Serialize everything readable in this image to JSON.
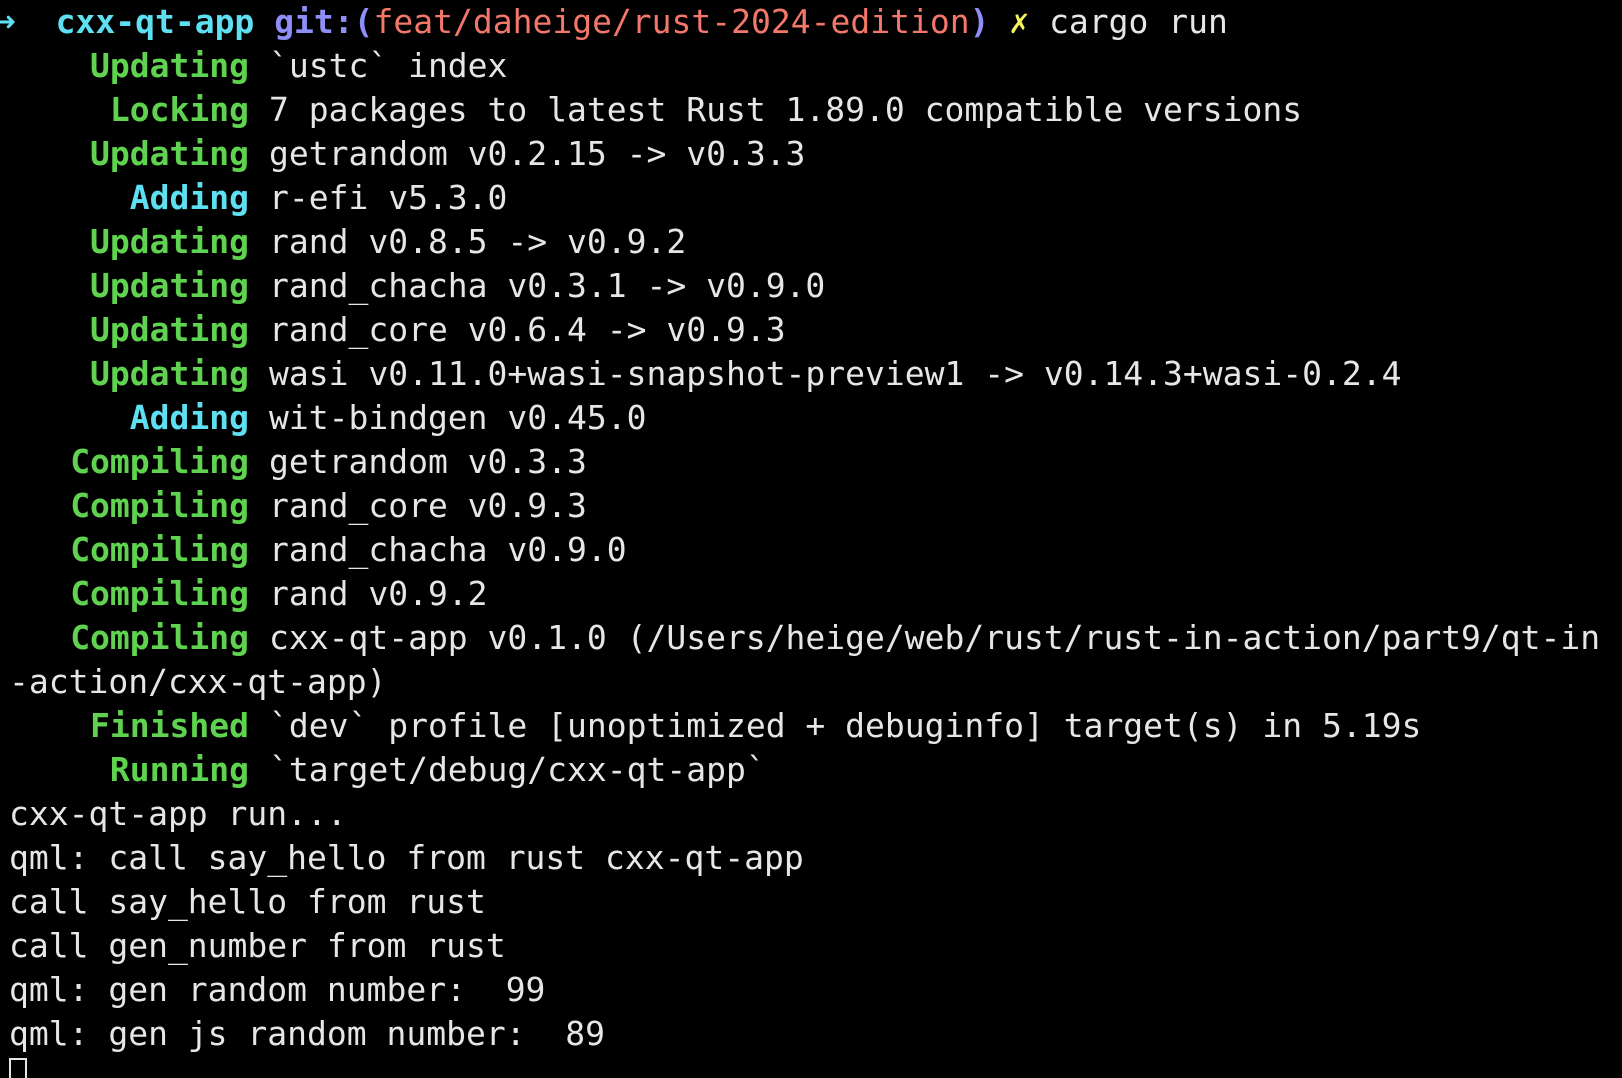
{
  "prompt": {
    "arrow": "➜",
    "dir": "cxx-qt-app",
    "git_prefix": "git:(",
    "branch": "feat/daheige/rust-2024-edition",
    "git_suffix": ")",
    "dirty_marker": "✗",
    "command": "cargo run"
  },
  "cargo_lines": [
    {
      "label": "Updating",
      "color": "green",
      "text": "`ustc` index"
    },
    {
      "label": "Locking",
      "color": "green",
      "text": "7 packages to latest Rust 1.89.0 compatible versions"
    },
    {
      "label": "Updating",
      "color": "green",
      "text": "getrandom v0.2.15 -> v0.3.3"
    },
    {
      "label": "Adding",
      "color": "cyan",
      "text": "r-efi v5.3.0"
    },
    {
      "label": "Updating",
      "color": "green",
      "text": "rand v0.8.5 -> v0.9.2"
    },
    {
      "label": "Updating",
      "color": "green",
      "text": "rand_chacha v0.3.1 -> v0.9.0"
    },
    {
      "label": "Updating",
      "color": "green",
      "text": "rand_core v0.6.4 -> v0.9.3"
    },
    {
      "label": "Updating",
      "color": "green",
      "text": "wasi v0.11.0+wasi-snapshot-preview1 -> v0.14.3+wasi-0.2.4"
    },
    {
      "label": "Adding",
      "color": "cyan",
      "text": "wit-bindgen v0.45.0"
    },
    {
      "label": "Compiling",
      "color": "green",
      "text": "getrandom v0.3.3"
    },
    {
      "label": "Compiling",
      "color": "green",
      "text": "rand_core v0.9.3"
    },
    {
      "label": "Compiling",
      "color": "green",
      "text": "rand_chacha v0.9.0"
    },
    {
      "label": "Compiling",
      "color": "green",
      "text": "rand v0.9.2"
    },
    {
      "label": "Compiling",
      "color": "green",
      "text": "cxx-qt-app v0.1.0 (/Users/heige/web/rust/rust-in-action/part9/qt-in"
    }
  ],
  "wrap_line": "-action/cxx-qt-app)",
  "finish_lines": [
    {
      "label": "Finished",
      "color": "green",
      "text": "`dev` profile [unoptimized + debuginfo] target(s) in 5.19s"
    },
    {
      "label": "Running",
      "color": "green",
      "text": "`target/debug/cxx-qt-app`"
    }
  ],
  "output_lines": [
    "cxx-qt-app run...",
    "qml: call say_hello from rust cxx-qt-app",
    "call say_hello from rust",
    "call gen_number from rust",
    "qml: gen random number:  99",
    "qml: gen js random number:  89"
  ],
  "colors": {
    "background": "#000000",
    "foreground": "#e6e6e6",
    "green": "#5fd34f",
    "cyan": "#5ee0f2",
    "git": "#8e8ef7",
    "branch": "#f3776a",
    "dirty": "#f6f25b"
  }
}
